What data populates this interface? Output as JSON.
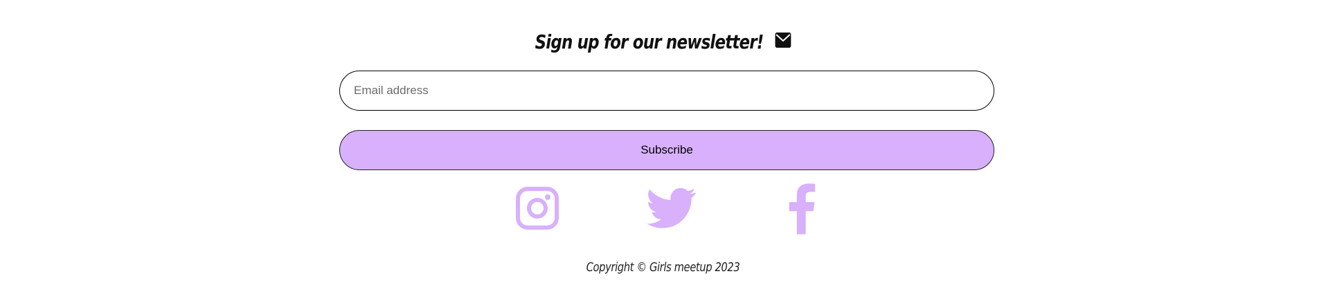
{
  "newsletter": {
    "heading": "Sign up for our newsletter!",
    "icon": "envelope-icon",
    "email_placeholder": "Email address",
    "email_value": "",
    "subscribe_label": "Subscribe"
  },
  "social": {
    "icons": [
      "instagram-icon",
      "twitter-icon",
      "facebook-icon"
    ],
    "color": "#d8b0fb"
  },
  "colors": {
    "accent": "#d8b0fb",
    "text": "#111111",
    "background": "#ffffff"
  },
  "footer": {
    "copyright": "Copyright © Girls meetup 2023"
  }
}
